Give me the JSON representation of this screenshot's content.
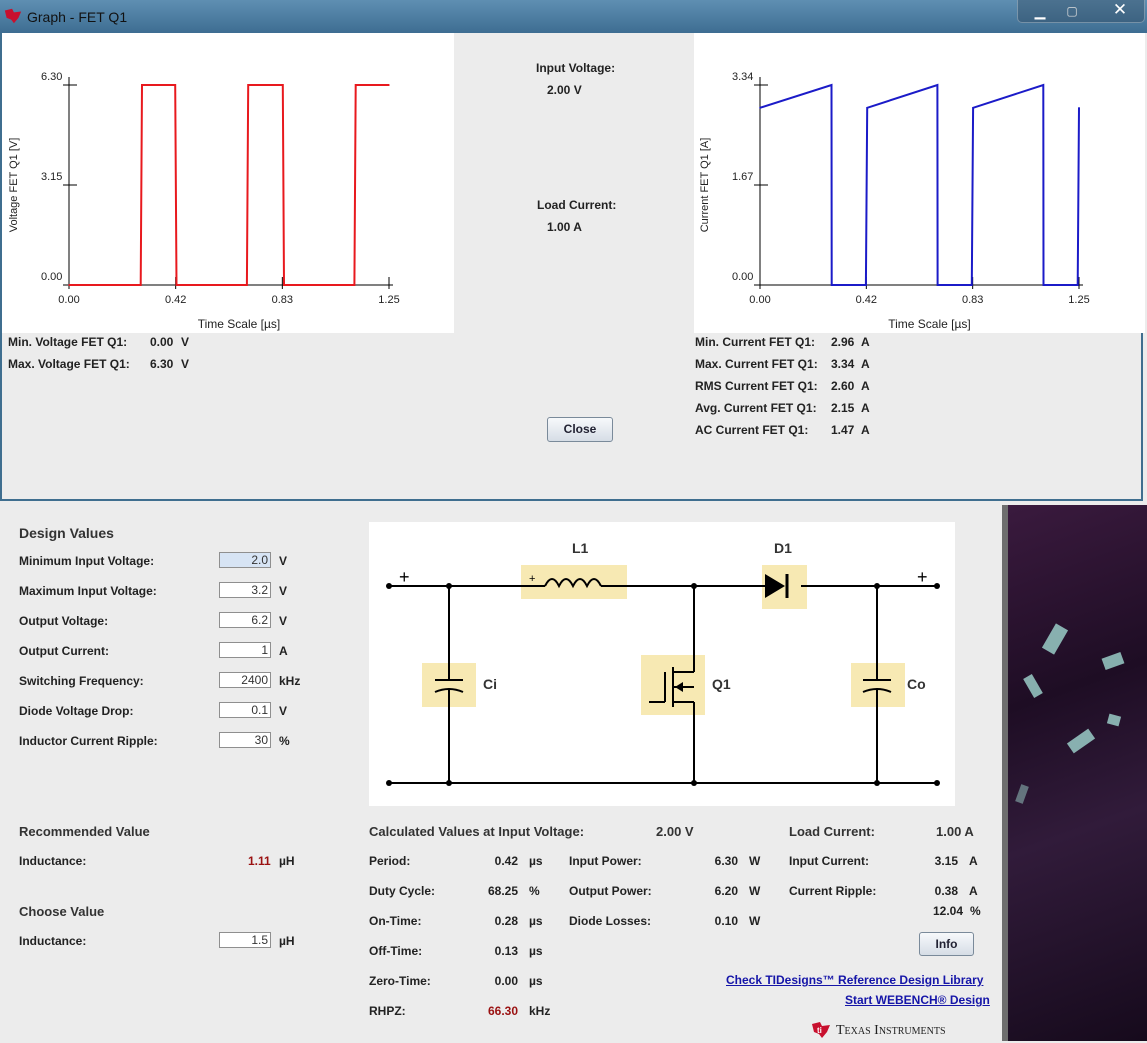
{
  "titlebar": {
    "title": "Graph - FET Q1"
  },
  "graph": {
    "input_voltage_label": "Input Voltage:",
    "input_voltage_value": "2.00 V",
    "load_current_label": "Load Current:",
    "load_current_value": "1.00 A",
    "close_label": "Close",
    "voltage_stats": [
      {
        "label": "Min. Voltage FET Q1:",
        "value": "0.00",
        "unit": "V"
      },
      {
        "label": "Max. Voltage FET Q1:",
        "value": "6.30",
        "unit": "V"
      }
    ],
    "current_stats": [
      {
        "label": "Min. Current FET Q1:",
        "value": "2.96",
        "unit": "A"
      },
      {
        "label": "Max. Current FET Q1:",
        "value": "3.34",
        "unit": "A"
      },
      {
        "label": "RMS Current FET Q1:",
        "value": "2.60",
        "unit": "A"
      },
      {
        "label": "Avg. Current FET Q1:",
        "value": "2.15",
        "unit": "A"
      },
      {
        "label": "AC Current FET Q1:",
        "value": "1.47",
        "unit": "A"
      }
    ]
  },
  "chart_data": [
    {
      "type": "line",
      "ylabel": "Voltage FET Q1 [V]",
      "xlabel": "Time Scale  [µs]",
      "xlim": [
        0,
        1.25
      ],
      "ylim": [
        0,
        6.3
      ],
      "xticks": [
        "0.00",
        "0.42",
        "0.83",
        "1.25"
      ],
      "yticks": [
        "0.00",
        "3.15",
        "6.30"
      ],
      "color": "#e8191e",
      "x": [
        0,
        0.28,
        0.285,
        0.415,
        0.42,
        0.695,
        0.7,
        0.835,
        0.84,
        1.115,
        1.12,
        1.25
      ],
      "y": [
        0,
        0,
        6.3,
        6.3,
        0,
        0,
        6.3,
        6.3,
        0,
        0,
        6.3,
        6.3
      ]
    },
    {
      "type": "line",
      "ylabel": "Current FET Q1 [A]",
      "xlabel": "Time Scale  [µs]",
      "xlim": [
        0,
        1.25
      ],
      "ylim": [
        0,
        3.34
      ],
      "xticks": [
        "0.00",
        "0.42",
        "0.83",
        "1.25"
      ],
      "yticks": [
        "0.00",
        "1.67",
        "3.34"
      ],
      "color": "#1b1bc8",
      "x": [
        0,
        0.28,
        0.281,
        0.41,
        0.415,
        0.42,
        0.695,
        0.696,
        0.825,
        0.83,
        0.835,
        1.11,
        1.111,
        1.24,
        1.245,
        1.25
      ],
      "y": [
        2.96,
        3.34,
        0,
        0,
        0,
        2.96,
        3.34,
        0,
        0,
        0,
        2.96,
        3.34,
        0,
        0,
        0,
        2.96
      ]
    }
  ],
  "design": {
    "heading": "Design Values",
    "rows": [
      {
        "label": "Minimum Input Voltage:",
        "value": "2.0",
        "unit": "V"
      },
      {
        "label": "Maximum Input Voltage:",
        "value": "3.2",
        "unit": "V"
      },
      {
        "label": "Output Voltage:",
        "value": "6.2",
        "unit": "V"
      },
      {
        "label": "Output Current:",
        "value": "1",
        "unit": "A"
      },
      {
        "label": "Switching Frequency:",
        "value": "2400",
        "unit": "kHz"
      },
      {
        "label": "Diode Voltage Drop:",
        "value": "0.1",
        "unit": "V"
      },
      {
        "label": "Inductor Current Ripple:",
        "value": "30",
        "unit": "%"
      }
    ]
  },
  "circuit": {
    "L1": "L1",
    "D1": "D1",
    "Ci": "Ci",
    "Q1": "Q1",
    "Co": "Co",
    "plus": "+"
  },
  "recommended": {
    "heading": "Recommended Value",
    "label": "Inductance:",
    "value": "1.11",
    "unit": "µH"
  },
  "choose": {
    "heading": "Choose Value",
    "label": "Inductance:",
    "value": "1.5",
    "unit": "µH"
  },
  "calc": {
    "heading": "Calculated Values at Input Voltage:",
    "heading_value": "2.00 V",
    "rows": [
      {
        "label": "Period:",
        "value": "0.42",
        "unit": "µs"
      },
      {
        "label": "Duty Cycle:",
        "value": "68.25",
        "unit": "%"
      },
      {
        "label": "On-Time:",
        "value": "0.28",
        "unit": "µs"
      },
      {
        "label": "Off-Time:",
        "value": "0.13",
        "unit": "µs"
      },
      {
        "label": "Zero-Time:",
        "value": "0.00",
        "unit": "µs"
      },
      {
        "label": "RHPZ:",
        "value": "66.30",
        "unit": "kHz"
      }
    ],
    "power": [
      {
        "label": "Input Power:",
        "value": "6.30",
        "unit": "W"
      },
      {
        "label": "Output Power:",
        "value": "6.20",
        "unit": "W"
      },
      {
        "label": "Diode Losses:",
        "value": "0.10",
        "unit": "W"
      }
    ]
  },
  "load": {
    "heading": "Load Current:",
    "heading_value": "1.00 A",
    "rows": [
      {
        "label": "Input Current:",
        "value": "3.15",
        "unit": "A"
      },
      {
        "label": "Current Ripple:",
        "value": "0.38",
        "unit": "A"
      }
    ],
    "ripple_pct": "12.04",
    "ripple_pct_unit": "%",
    "info_label": "Info"
  },
  "links": {
    "tidesigns": "Check TIDesigns™ Reference Design Library",
    "webench": "Start WEBENCH® Design"
  },
  "brand": {
    "name": "Texas Instruments",
    "color": "#c8102e"
  }
}
